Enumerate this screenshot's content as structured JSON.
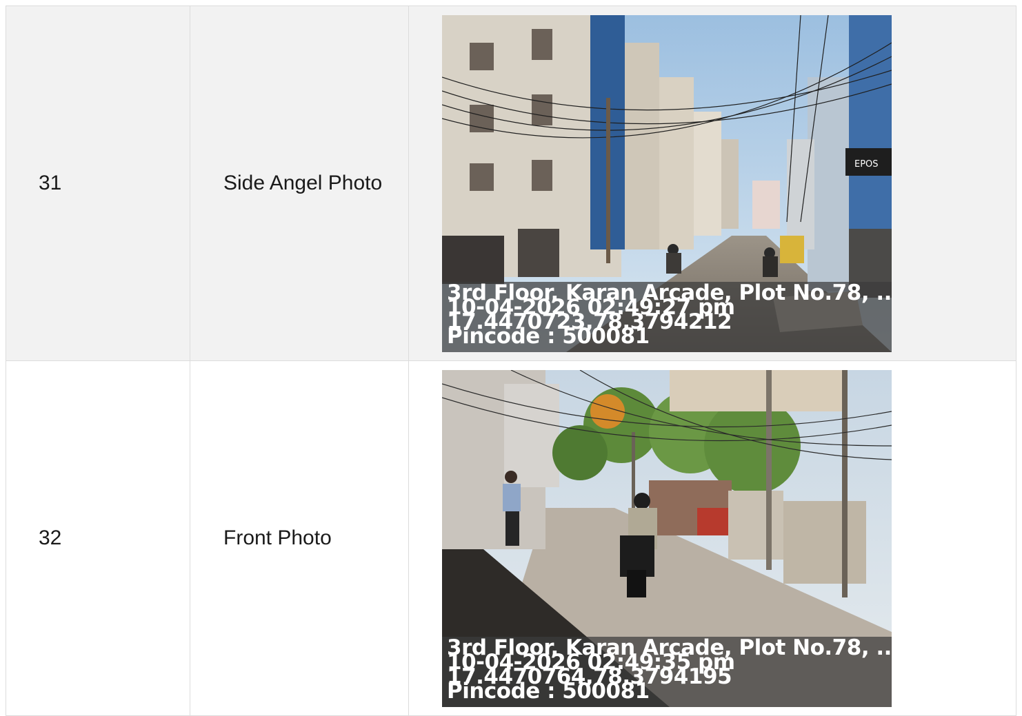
{
  "rows": [
    {
      "sr": "31",
      "label": "Side Angel Photo",
      "photo": {
        "address": "3rd Floor, Karan Arcade, Plot No.78, ...",
        "datetime": "10-04-2026 02:49:27 pm",
        "coords": "17.4470723,78.3794212",
        "pincode": "Pincode : 500081",
        "sign_text": "EPOS"
      }
    },
    {
      "sr": "32",
      "label": "Front Photo",
      "photo": {
        "address": "3rd Floor, Karan Arcade, Plot No.78, ...",
        "datetime": "10-04-2026 02:49:35 pm",
        "coords": "17.4470764,78.3794195",
        "pincode": "Pincode : 500081"
      }
    }
  ],
  "colors": {
    "row_alt_bg": "#f2f2f2",
    "border": "#dcdcdc",
    "stamp_bg": "#3c3c3c"
  }
}
